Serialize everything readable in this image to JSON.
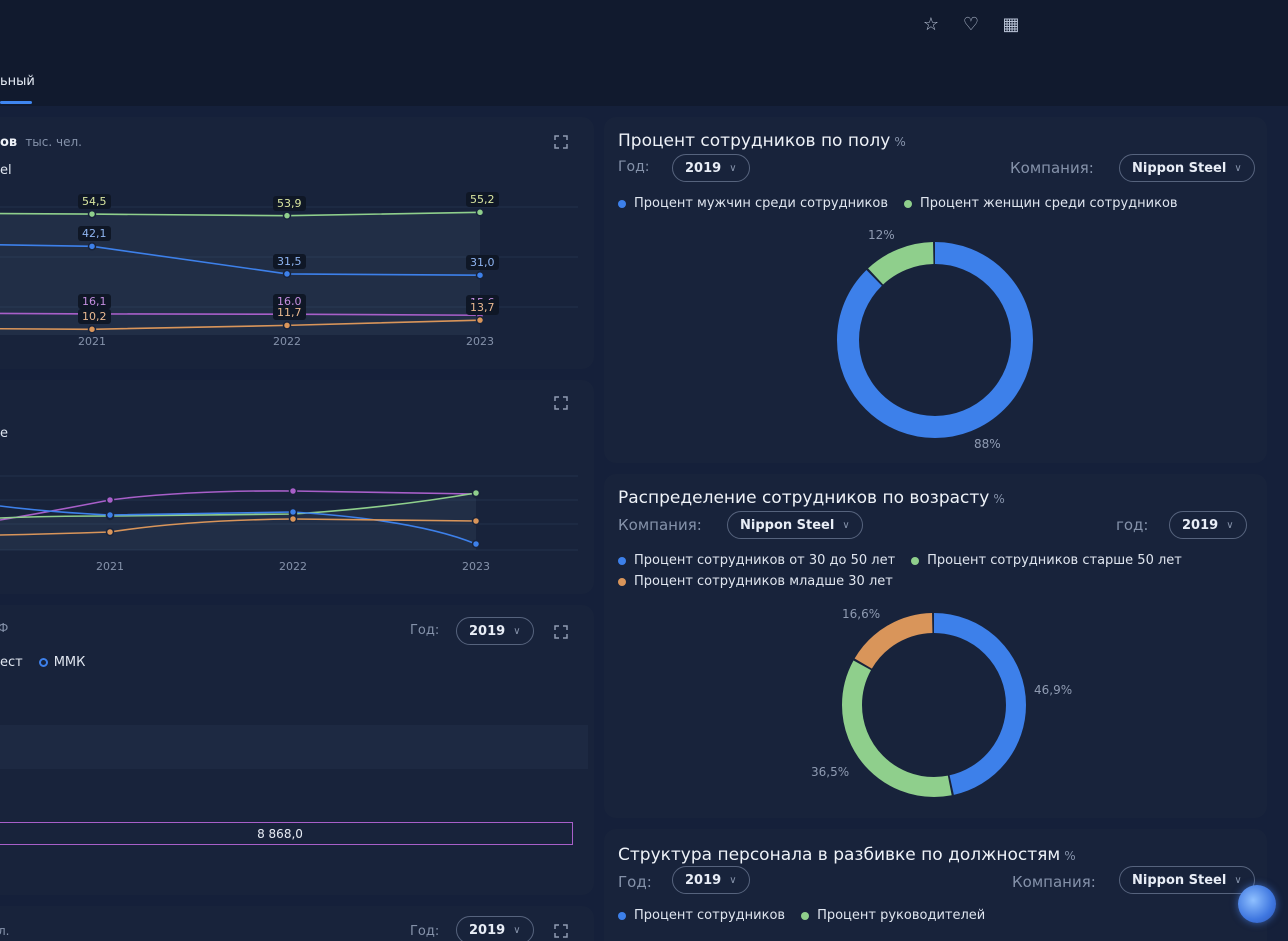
{
  "header": {
    "active_tab": "ьный",
    "icons": [
      "star-icon",
      "heart-icon",
      "dashboard-add-icon"
    ]
  },
  "card1": {
    "title": "ов",
    "unit": "тыс. чел.",
    "legend_fragment": "el",
    "x_labels": [
      "2021",
      "2022",
      "2023"
    ],
    "labels": {
      "green": [
        "54,5",
        "53,9",
        "55,2"
      ],
      "blue": [
        "42,1",
        "31,5",
        "31,0"
      ],
      "purple": [
        "16,1",
        "16,0",
        "15,6"
      ],
      "orange": [
        "10,2",
        "11,7",
        "13,7"
      ]
    }
  },
  "card2": {
    "legend_fragment": "e",
    "x_labels": [
      "2021",
      "2022",
      "2023"
    ]
  },
  "card3": {
    "title_fragment": "Ф",
    "year_label": "Год:",
    "year_value": "2019",
    "legend_fragment": "ест",
    "legend_mmk": "ММК",
    "bar_value": "8 868,0"
  },
  "card4": {
    "title_fragment": "л.",
    "year_label": "Год:",
    "year_value": "2019"
  },
  "gender": {
    "title": "Процент сотрудников по полу",
    "unit": "%",
    "year_label": "Год:",
    "year_value": "2019",
    "company_label": "Компания:",
    "company_value": "Nippon Steel",
    "legend": [
      "Процент мужчин среди сотрудников",
      "Процент женщин среди сотрудников"
    ],
    "pct_male": "88%",
    "pct_female": "12%"
  },
  "age": {
    "title": "Распределение сотрудников по возрасту",
    "unit": "%",
    "company_label": "Компания:",
    "company_value": "Nippon Steel",
    "year_label": "год:",
    "year_value": "2019",
    "legend": [
      "Процент сотрудников от 30 до 50 лет",
      "Процент сотрудников старше 50 лет",
      "Процент сотрудников младше 30 лет"
    ],
    "pct_mid": "46,9%",
    "pct_old": "36,5%",
    "pct_young": "16,6%"
  },
  "structure": {
    "title": "Структура персонала в разбивке по должностям",
    "unit": "%",
    "year_label": "Год:",
    "year_value": "2019",
    "company_label": "Компания:",
    "company_value": "Nippon Steel",
    "legend": [
      "Процент сотрудников",
      "Процент руководителей"
    ]
  },
  "colors": {
    "blue": "#3d80ea",
    "green": "#8fcf8c",
    "orange": "#d9955a",
    "purple": "#a85fc9"
  },
  "chart_data": [
    {
      "type": "pie",
      "title": "Процент сотрудников по полу",
      "categories": [
        "Процент мужчин среди сотрудников",
        "Процент женщин среди сотрудников"
      ],
      "values": [
        88,
        12
      ]
    },
    {
      "type": "pie",
      "title": "Распределение сотрудников по возрасту",
      "categories": [
        "Процент сотрудников от 30 до 50 лет",
        "Процент сотрудников старше 50 лет",
        "Процент сотрудников младше 30 лет"
      ],
      "values": [
        46.9,
        36.5,
        16.6
      ]
    },
    {
      "type": "line",
      "categories": [
        "2021",
        "2022",
        "2023"
      ],
      "series": [
        {
          "values": [
            54.5,
            53.9,
            55.2
          ]
        },
        {
          "values": [
            42.1,
            31.5,
            31.0
          ]
        },
        {
          "values": [
            16.1,
            16.0,
            15.6
          ]
        },
        {
          "values": [
            10.2,
            11.7,
            13.7
          ]
        }
      ]
    }
  ]
}
